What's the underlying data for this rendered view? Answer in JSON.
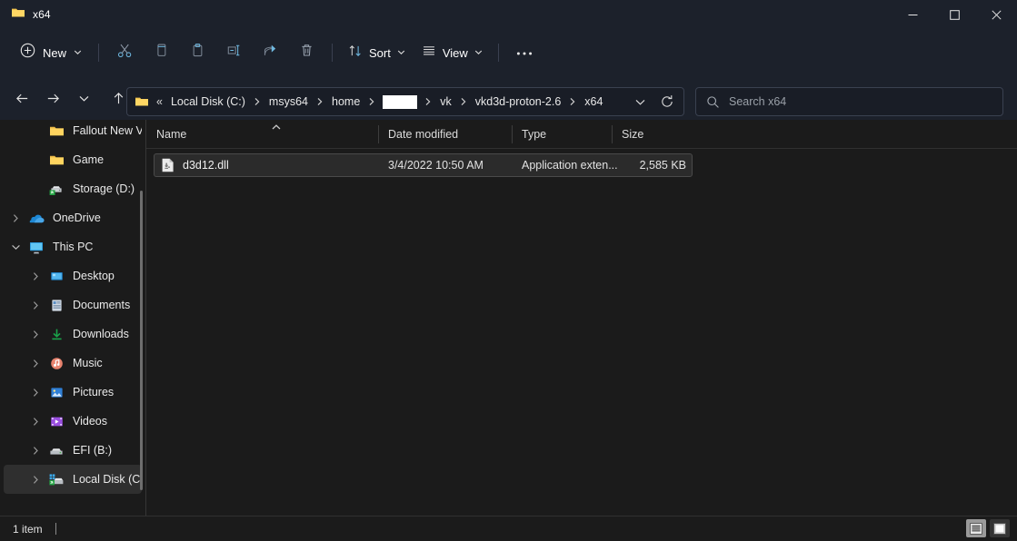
{
  "window": {
    "title": "x64",
    "folder_icon": "folder-icon",
    "controls": [
      {
        "name": "minimize-button",
        "glyph": "minimize-icon"
      },
      {
        "name": "maximize-button",
        "glyph": "maximize-icon"
      },
      {
        "name": "close-button",
        "glyph": "close-icon"
      }
    ]
  },
  "toolbar": {
    "new_label": "New",
    "new_icon": "plus-circle-icon",
    "icon_buttons": [
      {
        "name": "cut-button",
        "icon": "scissors-icon"
      },
      {
        "name": "copy-button",
        "icon": "copy-icon"
      },
      {
        "name": "paste-button",
        "icon": "paste-icon"
      },
      {
        "name": "rename-button",
        "icon": "rename-icon"
      },
      {
        "name": "share-button",
        "icon": "share-icon"
      },
      {
        "name": "delete-button",
        "icon": "trash-icon"
      }
    ],
    "sort_label": "Sort",
    "sort_icon": "sort-arrows-icon",
    "view_label": "View",
    "view_icon": "list-lines-icon",
    "more_label": "•••",
    "more_icon": "ellipsis-icon"
  },
  "navigation": {
    "back_icon": "arrow-left-icon",
    "forward_icon": "arrow-right-icon",
    "recent_icon": "chevron-down-icon",
    "up_icon": "arrow-up-icon",
    "address": {
      "leading_icon": "folder-icon",
      "overflow": "«",
      "crumbs": [
        {
          "label": "Local Disk (C:)",
          "redacted": false
        },
        {
          "label": "msys64",
          "redacted": false
        },
        {
          "label": "home",
          "redacted": false
        },
        {
          "label": "",
          "redacted": true
        },
        {
          "label": "vk",
          "redacted": false
        },
        {
          "label": "vkd3d-proton-2.6",
          "redacted": false
        },
        {
          "label": "x64",
          "redacted": false
        }
      ],
      "dropdown_icon": "chevron-down-icon",
      "refresh_icon": "refresh-icon"
    },
    "search": {
      "placeholder": "Search x64",
      "icon": "search-icon"
    }
  },
  "sidebar": {
    "scrollbar": true,
    "items": [
      {
        "label": "Fallout New Veg",
        "icon": "folder-icon",
        "expandable": false,
        "indent": 2,
        "selected": false
      },
      {
        "label": "Game",
        "icon": "folder-icon",
        "expandable": false,
        "indent": 2,
        "selected": false
      },
      {
        "label": "Storage (D:)",
        "icon": "drive-network-icon",
        "expandable": false,
        "indent": 2,
        "selected": false
      },
      {
        "label": "OneDrive",
        "icon": "onedrive-cloud-icon",
        "expandable": true,
        "indent": 0,
        "selected": false
      },
      {
        "label": "This PC",
        "icon": "this-pc-icon",
        "expandable": true,
        "expanded": true,
        "indent": 0,
        "selected": false
      },
      {
        "label": "Desktop",
        "icon": "desktop-icon",
        "expandable": true,
        "indent": 1,
        "selected": false
      },
      {
        "label": "Documents",
        "icon": "documents-icon",
        "expandable": true,
        "indent": 1,
        "selected": false
      },
      {
        "label": "Downloads",
        "icon": "downloads-icon",
        "expandable": true,
        "indent": 1,
        "selected": false
      },
      {
        "label": "Music",
        "icon": "music-icon",
        "expandable": true,
        "indent": 1,
        "selected": false
      },
      {
        "label": "Pictures",
        "icon": "pictures-icon",
        "expandable": true,
        "indent": 1,
        "selected": false
      },
      {
        "label": "Videos",
        "icon": "videos-icon",
        "expandable": true,
        "indent": 1,
        "selected": false
      },
      {
        "label": "EFI (B:)",
        "icon": "drive-icon",
        "expandable": true,
        "indent": 1,
        "selected": false
      },
      {
        "label": "Local Disk (C:)",
        "icon": "drive-windows-icon",
        "expandable": true,
        "indent": 1,
        "selected": true
      }
    ]
  },
  "filelist": {
    "columns": [
      {
        "label": "Name",
        "sorted": true,
        "sort_dir": "asc"
      },
      {
        "label": "Date modified",
        "sorted": false
      },
      {
        "label": "Type",
        "sorted": false
      },
      {
        "label": "Size",
        "sorted": false
      }
    ],
    "rows": [
      {
        "name": "d3d12.dll",
        "icon": "dll-file-icon",
        "date_modified": "3/4/2022 10:50 AM",
        "type": "Application exten...",
        "size": "2,585 KB",
        "selected": true
      }
    ]
  },
  "statusbar": {
    "item_count": "1 item",
    "views": [
      {
        "name": "details-view-button",
        "icon": "details-view-icon",
        "active": true
      },
      {
        "name": "large-icons-view-button",
        "icon": "large-icons-view-icon",
        "active": false
      }
    ]
  },
  "colors": {
    "titlebar_bg": "#1c212b",
    "content_bg": "#1b1b1b",
    "accent_blue": "#4fa3d1",
    "folder_yellow": "#f2c44d",
    "selection_bg": "#2f2f2f"
  }
}
